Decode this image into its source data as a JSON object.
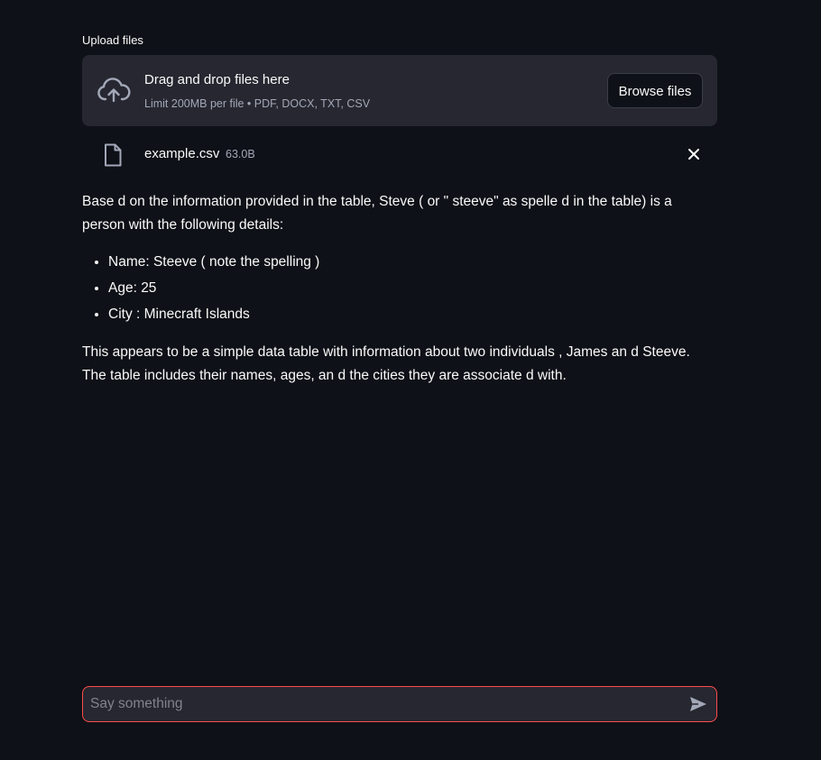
{
  "uploader": {
    "label": "Upload files",
    "drop_title": "Drag and drop files here",
    "drop_subtitle": "Limit 200MB per file • PDF, DOCX, TXT, CSV",
    "browse_label": "Browse files",
    "icon": "cloud-upload-icon"
  },
  "file": {
    "name": "example.csv",
    "size": "63.0B",
    "icon": "file-icon",
    "remove_icon": "close-icon"
  },
  "response": {
    "intro": "Base d on the information provided in the table, Steve ( or \" steeve\" as spelle d in the table) is a person with the following details:",
    "details": [
      "Name: Steeve ( note the spelling )",
      "Age: 25",
      "City : Minecraft Islands"
    ],
    "summary": "This appears to be a simple data table with information about two individuals , James an d Steeve. The table includes their names, ages, an d the cities they are associate d with."
  },
  "chat": {
    "placeholder": "Say something",
    "value": "",
    "send_icon": "send-icon"
  },
  "colors": {
    "background": "#0e1117",
    "surface": "#262730",
    "accent": "#ff4b4b",
    "text": "#fafafa",
    "muted": "#a3a8b8"
  }
}
